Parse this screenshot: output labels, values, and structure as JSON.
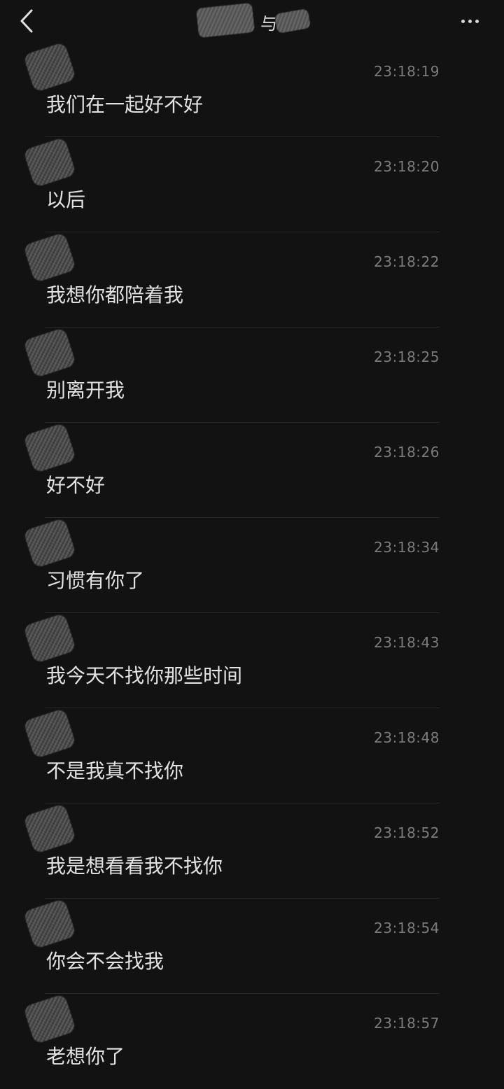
{
  "header": {
    "back_icon": "chevron-left-icon",
    "title": "与",
    "more_icon": "more-dots-icon"
  },
  "messages": [
    {
      "time": "23:18:19",
      "text": "我们在一起好不好"
    },
    {
      "time": "23:18:20",
      "text": "以后"
    },
    {
      "time": "23:18:22",
      "text": "我想你都陪着我"
    },
    {
      "time": "23:18:25",
      "text": "别离开我"
    },
    {
      "time": "23:18:26",
      "text": "好不好"
    },
    {
      "time": "23:18:34",
      "text": "习惯有你了"
    },
    {
      "time": "23:18:43",
      "text": "我今天不找你那些时间"
    },
    {
      "time": "23:18:48",
      "text": "不是我真不找你"
    },
    {
      "time": "23:18:52",
      "text": "我是想看看我不找你"
    },
    {
      "time": "23:18:54",
      "text": "你会不会找我"
    },
    {
      "time": "23:18:57",
      "text": "老想你了"
    }
  ],
  "colors": {
    "background": "#121212",
    "text": "#e3e3e3",
    "timestamp": "#7c7c7c",
    "divider": "#2a2a2a"
  }
}
